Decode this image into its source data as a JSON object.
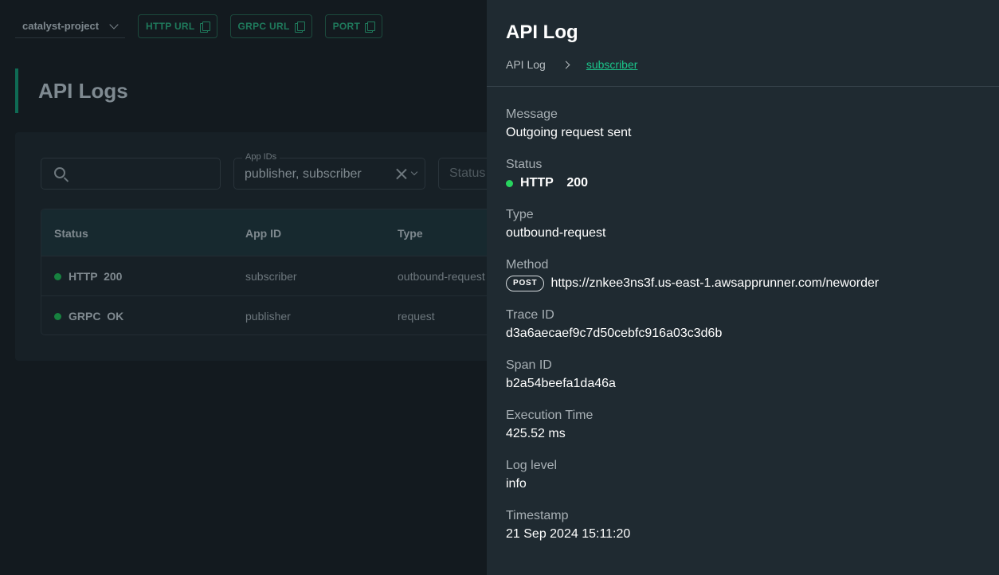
{
  "topbar": {
    "project": "catalyst-project",
    "buttons": [
      "HTTP URL",
      "GRPC URL",
      "PORT"
    ]
  },
  "page": {
    "title": "API Logs"
  },
  "filters": {
    "app_ids_label": "App IDs",
    "app_ids_value": "publisher, subscriber",
    "status_placeholder": "Status"
  },
  "table": {
    "headers": {
      "status": "Status",
      "app_id": "App ID",
      "type": "Type"
    },
    "rows": [
      {
        "status": "HTTP  200",
        "app_id": "subscriber",
        "type": "outbound-request"
      },
      {
        "status": "GRPC  OK",
        "app_id": "publisher",
        "type": "request"
      }
    ]
  },
  "drawer": {
    "title": "API Log",
    "breadcrumb": {
      "root": "API Log",
      "current": "subscriber"
    },
    "fields": {
      "message": {
        "label": "Message",
        "value": "Outgoing request sent"
      },
      "status": {
        "label": "Status",
        "value": "HTTP  200"
      },
      "type": {
        "label": "Type",
        "value": "outbound-request"
      },
      "method": {
        "label": "Method",
        "badge": "POST",
        "value": "https://znkee3ns3f.us-east-1.awsapprunner.com/neworder"
      },
      "trace_id": {
        "label": "Trace ID",
        "value": "d3a6aecaef9c7d50cebfc916a03c3d6b"
      },
      "span_id": {
        "label": "Span ID",
        "value": "b2a54beefa1da46a"
      },
      "execution_time": {
        "label": "Execution Time",
        "value": "425.52 ms"
      },
      "log_level": {
        "label": "Log level",
        "value": "info"
      },
      "timestamp": {
        "label": "Timestamp",
        "value": "21 Sep 2024 15:11:20"
      }
    }
  },
  "colors": {
    "accent": "#1bc48a",
    "status_ok": "#27d45e",
    "drawer_bg": "#1f2a31",
    "page_bg": "#131a1f"
  }
}
